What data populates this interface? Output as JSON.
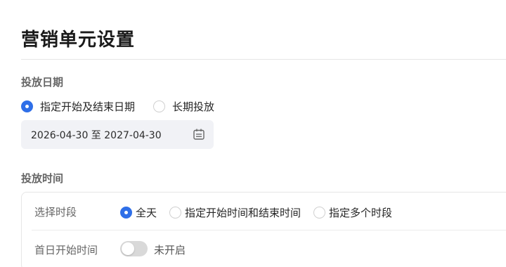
{
  "page": {
    "title": "营销单元设置"
  },
  "delivery_date": {
    "label": "投放日期",
    "options": [
      {
        "label": "指定开始及结束日期",
        "checked": true
      },
      {
        "label": "长期投放",
        "checked": false
      }
    ],
    "date_range": {
      "value": "2026-04-30 至 2027-04-30",
      "icon": "calendar-icon"
    }
  },
  "delivery_time": {
    "label": "投放时间",
    "period": {
      "label": "选择时段",
      "options": [
        {
          "label": "全天",
          "checked": true
        },
        {
          "label": "指定开始时间和结束时间",
          "checked": false
        },
        {
          "label": "指定多个时段",
          "checked": false
        }
      ]
    },
    "first_day_start": {
      "label": "首日开始时间",
      "toggle_on": false,
      "toggle_text": "未开启"
    }
  },
  "colors": {
    "accent": "#2f6fe8",
    "toggle_off": "#d9d9d9"
  }
}
